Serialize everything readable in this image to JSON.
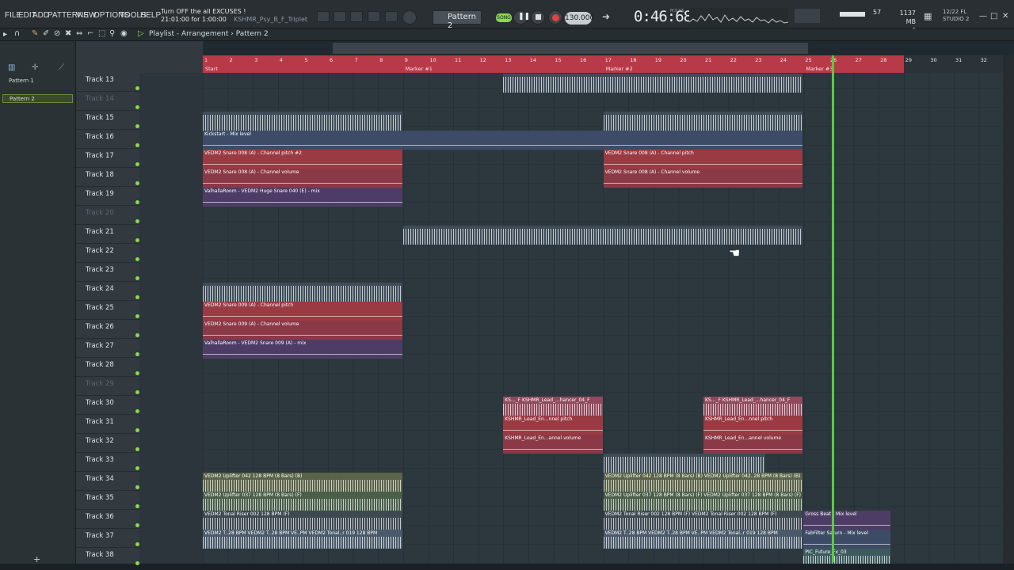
{
  "menu": [
    "FILE",
    "EDIT",
    "ADD",
    "PATTERNS",
    "VIEW",
    "OPTIONS",
    "TOOLS",
    "HELP"
  ],
  "hint": {
    "line1": "Turn OFF the all EXCUSES !",
    "line2": "21:01:00 for 1:00:00",
    "file": "KSHMR_Psy_B_F_Triplet"
  },
  "transport": {
    "pattern": "Pattern 2",
    "mode": "SONG",
    "tempo": "130.000",
    "time": "0:46:68",
    "time_unit": "M:S:CS"
  },
  "monitor": {
    "cpu": "57",
    "mem": "1137 MB",
    "voices": "6",
    "version_date": "12/22 FL",
    "version": "STUDIO 2"
  },
  "playlist": {
    "title": "Playlist - Arrangement",
    "sep": "›",
    "pattern": "Pattern 2"
  },
  "patterns": [
    "Pattern 1",
    "Pattern 2"
  ],
  "ruler": {
    "bars": [
      "1",
      "2",
      "3",
      "4",
      "5",
      "6",
      "7",
      "8",
      "9",
      "10",
      "11",
      "12",
      "13",
      "14",
      "15",
      "16",
      "17",
      "18",
      "19",
      "20",
      "21",
      "22",
      "23",
      "24",
      "25",
      "26",
      "27",
      "28",
      "29",
      "30",
      "31",
      "32"
    ],
    "markers": [
      "Start",
      "Marker #1",
      "Marker #2",
      "Marker #3"
    ]
  },
  "tracks": [
    {
      "name": "Track 13",
      "dim": false
    },
    {
      "name": "Track 14",
      "dim": true
    },
    {
      "name": "Track 15",
      "dim": false
    },
    {
      "name": "Track 16",
      "dim": false
    },
    {
      "name": "Track 17",
      "dim": false
    },
    {
      "name": "Track 18",
      "dim": false
    },
    {
      "name": "Track 19",
      "dim": false
    },
    {
      "name": "Track 20",
      "dim": true
    },
    {
      "name": "Track 21",
      "dim": false
    },
    {
      "name": "Track 22",
      "dim": false
    },
    {
      "name": "Track 23",
      "dim": false
    },
    {
      "name": "Track 24",
      "dim": false
    },
    {
      "name": "Track 25",
      "dim": false
    },
    {
      "name": "Track 26",
      "dim": false
    },
    {
      "name": "Track 27",
      "dim": false
    },
    {
      "name": "Track 28",
      "dim": false
    },
    {
      "name": "Track 29",
      "dim": true
    },
    {
      "name": "Track 30",
      "dim": false
    },
    {
      "name": "Track 31",
      "dim": false
    },
    {
      "name": "Track 32",
      "dim": false
    },
    {
      "name": "Track 33",
      "dim": false
    },
    {
      "name": "Track 34",
      "dim": false
    },
    {
      "name": "Track 35",
      "dim": false
    },
    {
      "name": "Track 36",
      "dim": false
    },
    {
      "name": "Track 37",
      "dim": false
    },
    {
      "name": "Track 38",
      "dim": false
    }
  ],
  "clips": [
    {
      "row": 3,
      "start": 0,
      "end": 24,
      "label": "Kickstart - Mix level",
      "kind": "c-auto-blue"
    },
    {
      "row": 4,
      "start": 0,
      "end": 8,
      "label": "VEDM2 Snare 008 (A) - Channel pitch #2",
      "kind": "c-auto-red"
    },
    {
      "row": 4,
      "start": 16,
      "end": 24,
      "label": "VEDM2 Snare 008 (A) - Channel pitch",
      "kind": "c-auto-red"
    },
    {
      "row": 5,
      "start": 0,
      "end": 8,
      "label": "VEDM2 Snare 008 (A) - Channel volume",
      "kind": "c-auto-red2"
    },
    {
      "row": 5,
      "start": 16,
      "end": 24,
      "label": "VEDM2 Snare 008 (A) - Channel volume",
      "kind": "c-auto-red2"
    },
    {
      "row": 6,
      "start": 0,
      "end": 8,
      "label": "ValhallaRoom - VEDM2 Huge Snare 040 (E) - mix",
      "kind": "c-auto-purple"
    },
    {
      "row": 12,
      "start": 0,
      "end": 8,
      "label": "VEDM2 Snare 009 (A) - Channel pitch",
      "kind": "c-auto-red"
    },
    {
      "row": 13,
      "start": 0,
      "end": 8,
      "label": "VEDM2 Snare 009 (A) - Channel volume",
      "kind": "c-auto-red2"
    },
    {
      "row": 14,
      "start": 0,
      "end": 8,
      "label": "ValhallaRoom - VEDM2 Snare 009 (A) - mix",
      "kind": "c-auto-purple"
    },
    {
      "row": 17,
      "start": 12,
      "end": 16,
      "label": "KS..._F  KSHMR_Lead_...hancer_04_F",
      "kind": "c-audio-pink"
    },
    {
      "row": 17,
      "start": 20,
      "end": 24,
      "label": "KS..._F  KSHMR_Lead_...hancer_04_F",
      "kind": "c-audio-pink"
    },
    {
      "row": 18,
      "start": 12,
      "end": 16,
      "label": "KSHMR_Lead_En...nnel pitch",
      "kind": "c-auto-red"
    },
    {
      "row": 18,
      "start": 20,
      "end": 24,
      "label": "KSHMR_Lead_En...nnel pitch",
      "kind": "c-auto-red"
    },
    {
      "row": 19,
      "start": 12,
      "end": 16,
      "label": "KSHMR_Lead_En...annel volume",
      "kind": "c-auto-red2"
    },
    {
      "row": 19,
      "start": 20,
      "end": 24,
      "label": "KSHMR_Lead_En...annel volume",
      "kind": "c-auto-red2"
    },
    {
      "row": 21,
      "start": 0,
      "end": 8,
      "label": "VEDM2 Uplifter 042 128 BPM (8 Bars) (B)",
      "kind": "c-olive"
    },
    {
      "row": 21,
      "start": 16,
      "end": 24,
      "label": "VEDM2 Uplifter 042 128 BPM (8 Bars) (B)  VEDM2 Uplifter 042..28 BPM (8 Bars) (B)",
      "kind": "c-olive"
    },
    {
      "row": 22,
      "start": 0,
      "end": 8,
      "label": "VEDM2 Uplifter 037 128 BPM (8 Bars) (F)",
      "kind": "c-green"
    },
    {
      "row": 22,
      "start": 16,
      "end": 24,
      "label": "VEDM2 Uplifter 037 128 BPM (8 Bars) (F)  VEDM2 Uplifter 037 128 BPM (8 Bars) (F)",
      "kind": "c-green"
    },
    {
      "row": 23,
      "start": 0,
      "end": 8,
      "label": "VEDM2 Tonal Riser 002 128 BPM (F)",
      "kind": "c-gray"
    },
    {
      "row": 23,
      "start": 16,
      "end": 24,
      "label": "VEDM2 Tonal Riser 002 128 BPM (F)  VEDM2 Tonal Riser 002 128 BPM (F)",
      "kind": "c-gray"
    },
    {
      "row": 23,
      "start": 24,
      "end": 27.5,
      "label": "Gross Beat - Mix level",
      "kind": "c-auto-purple"
    },
    {
      "row": 24,
      "start": 0,
      "end": 8,
      "label": "VEDM2 T..28 BPM  VEDM2 T..28 BPM  VE..PM  VEDM2 Tonal..r 019 128 BPM",
      "kind": "c-audio"
    },
    {
      "row": 24,
      "start": 16,
      "end": 24,
      "label": "VEDM2 T..28 BPM  VEDM2 T..28 BPM  VE..PM  VEDM2 Tonal..r 019 128 BPM",
      "kind": "c-audio"
    },
    {
      "row": 24,
      "start": 24,
      "end": 27.5,
      "label": "FabFilter Saturn - Mix level",
      "kind": "c-auto-blue"
    },
    {
      "row": 25,
      "start": 24,
      "end": 27.5,
      "label": "PIC_Future_Fx_03",
      "kind": "c-teal"
    }
  ],
  "wave_clips": [
    {
      "row": 0,
      "start": 12,
      "end": 24
    },
    {
      "row": 2,
      "start": 0,
      "end": 8
    },
    {
      "row": 2,
      "start": 16,
      "end": 24
    },
    {
      "row": 8,
      "start": 8,
      "end": 24
    },
    {
      "row": 11,
      "start": 0,
      "end": 8
    },
    {
      "row": 20,
      "start": 16,
      "end": 22.5
    }
  ]
}
